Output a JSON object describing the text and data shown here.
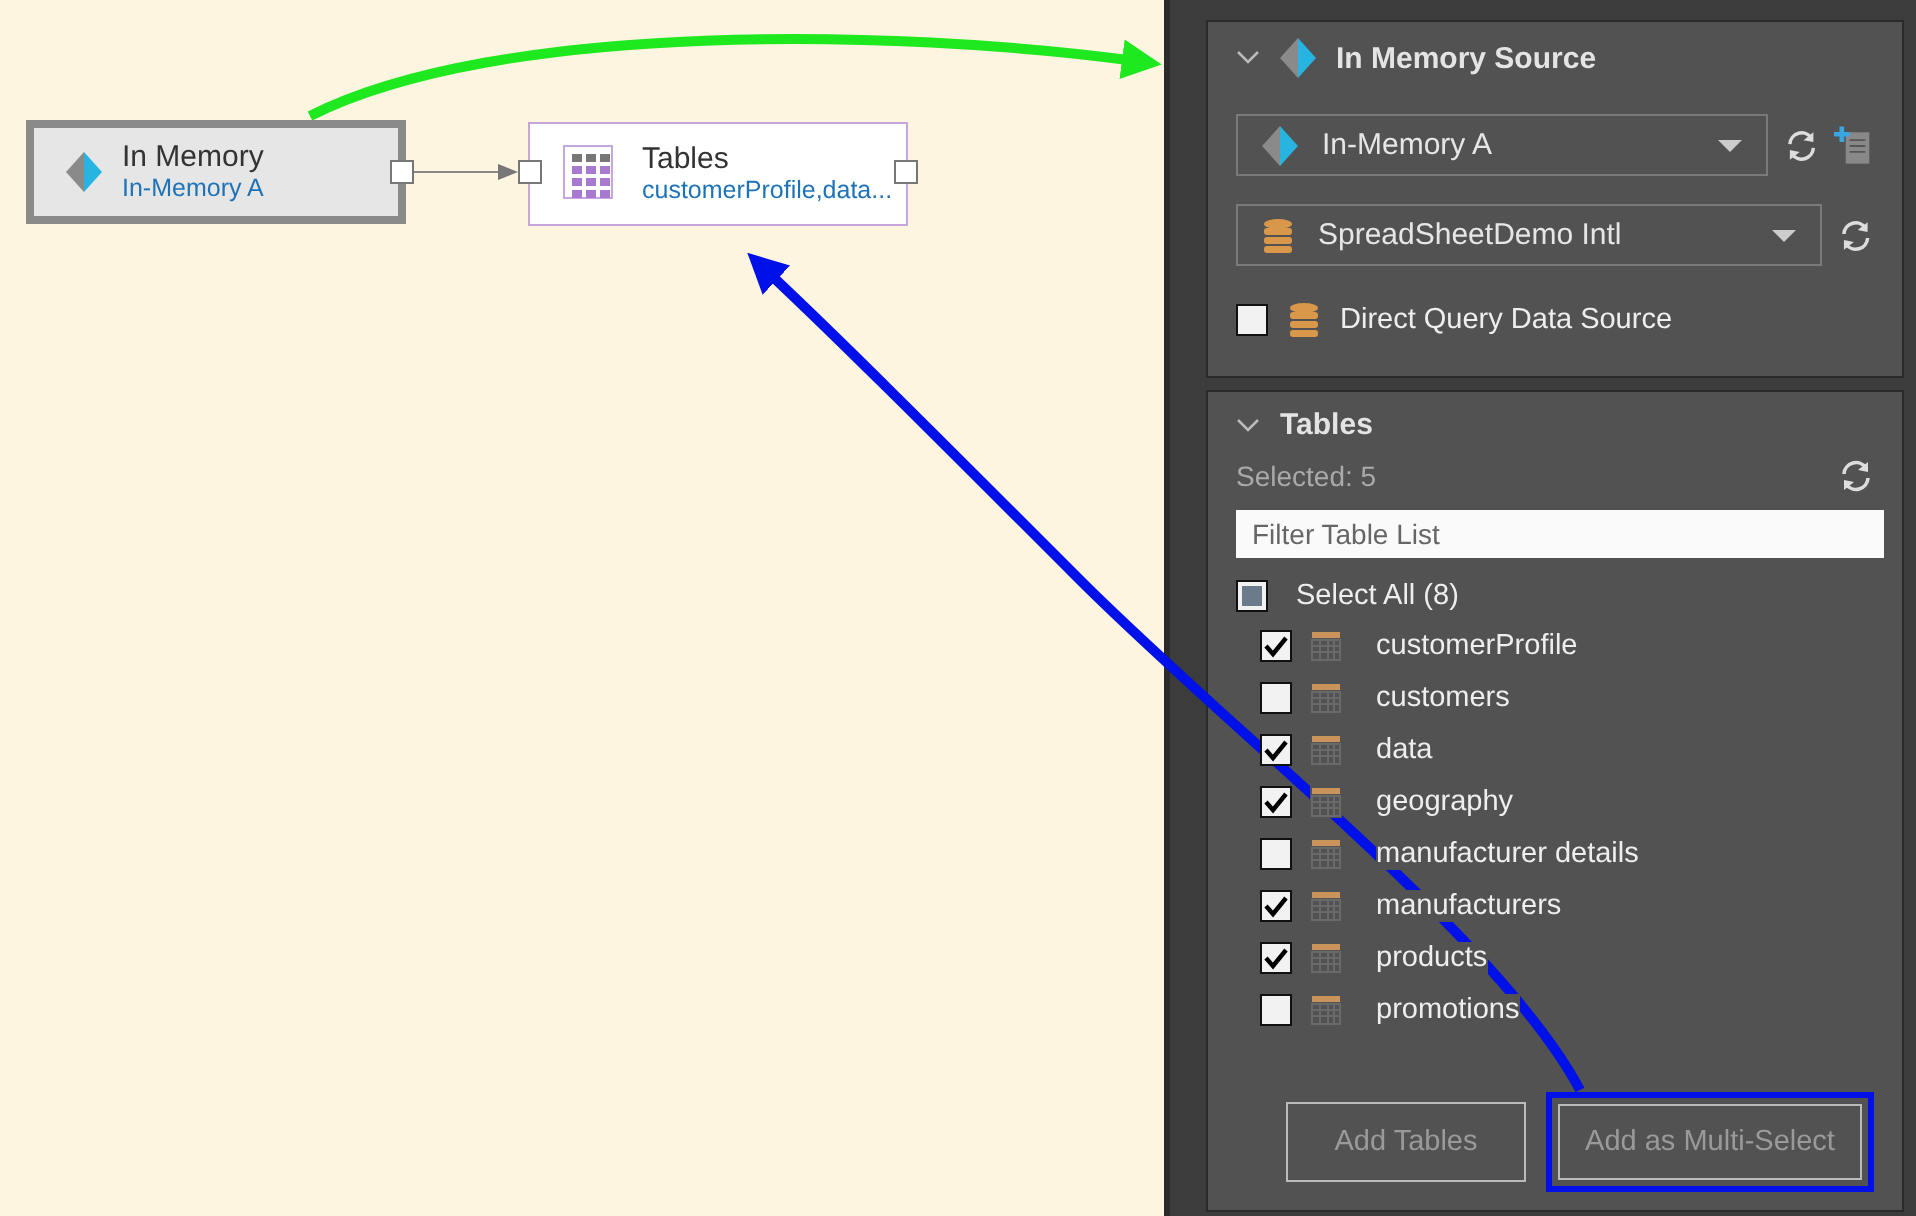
{
  "canvas": {
    "nodes": [
      {
        "kind": "source",
        "title": "In Memory",
        "subtitle": "In-Memory A",
        "selected": true
      },
      {
        "kind": "tables",
        "title": "Tables",
        "subtitle": "customerProfile,data...",
        "selected": false
      }
    ]
  },
  "source_section": {
    "title": "In Memory Source",
    "expanded": true,
    "connection": {
      "value": "In-Memory A"
    },
    "database": {
      "value": "SpreadSheetDemo Intl"
    },
    "direct_query": {
      "label": "Direct Query Data Source",
      "checked": false
    }
  },
  "tables_section": {
    "title": "Tables",
    "expanded": true,
    "selected_count": "Selected: 5",
    "filter": {
      "placeholder": "Filter Table List"
    },
    "select_all": {
      "label": "Select All (8)",
      "indeterminate": true
    },
    "tables": [
      {
        "name": "customerProfile",
        "checked": true
      },
      {
        "name": "customers",
        "checked": false
      },
      {
        "name": "data",
        "checked": true
      },
      {
        "name": "geography",
        "checked": true
      },
      {
        "name": "manufacturer details",
        "checked": false
      },
      {
        "name": "manufacturers",
        "checked": true
      },
      {
        "name": "products",
        "checked": true
      },
      {
        "name": "promotions",
        "checked": false
      }
    ],
    "buttons": [
      {
        "label": "Add Tables",
        "highlighted": false
      },
      {
        "label": "Add as Multi-Select",
        "highlighted": true
      }
    ]
  }
}
